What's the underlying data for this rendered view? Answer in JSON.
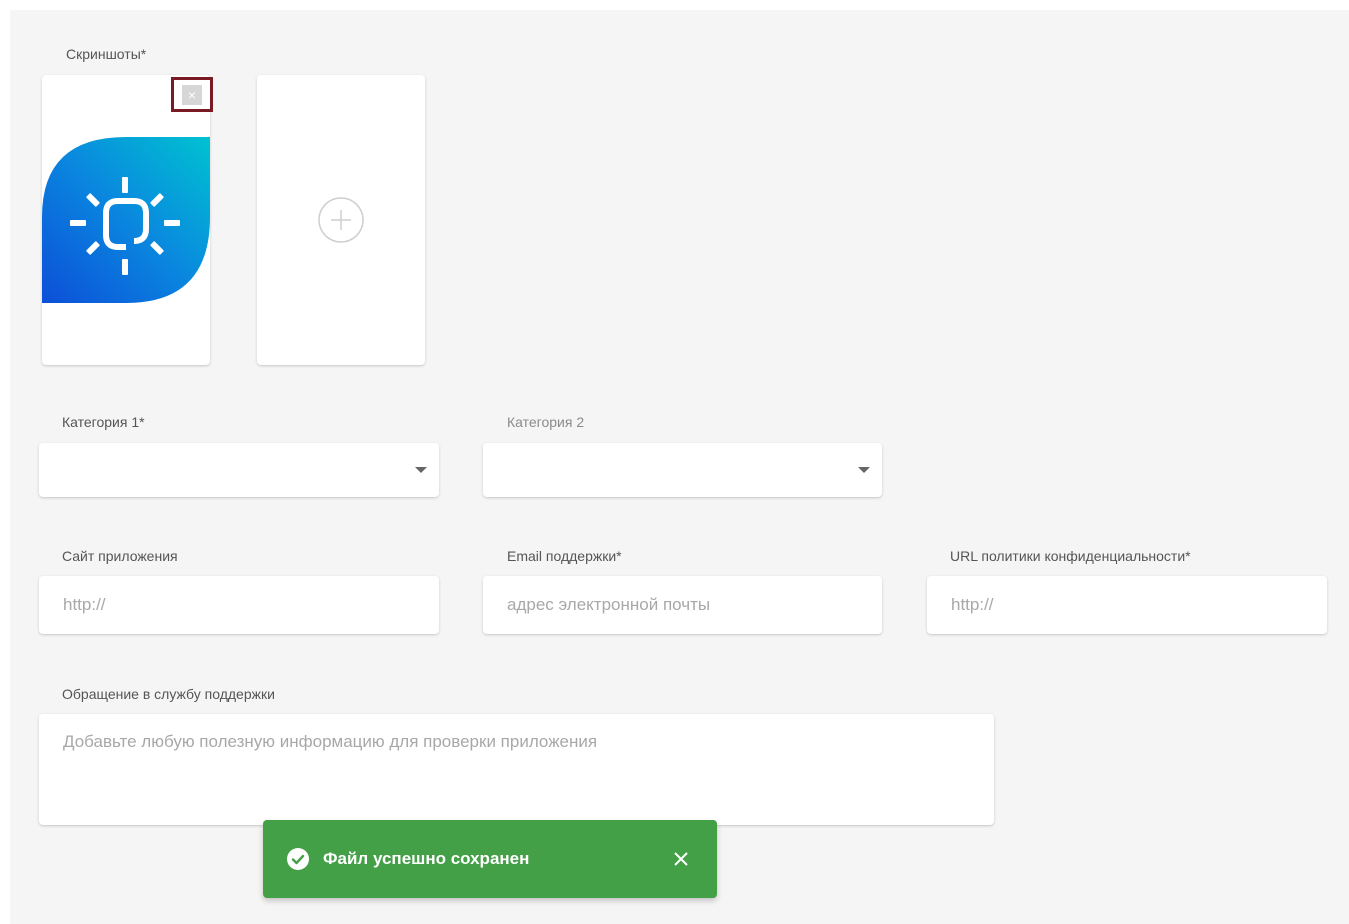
{
  "screenshots": {
    "label": "Скриншоты*",
    "remove_symbol": "×",
    "add_icon": "plus-circle-icon"
  },
  "category1": {
    "label": "Категория 1*",
    "value": ""
  },
  "category2": {
    "label": "Категория 2",
    "value": ""
  },
  "site": {
    "label": "Сайт приложения",
    "placeholder": "http://",
    "value": ""
  },
  "support_email": {
    "label": "Email поддержки*",
    "placeholder": "адрес электронной почты",
    "value": ""
  },
  "privacy_url": {
    "label": "URL политики конфиденциальности*",
    "placeholder": "http://",
    "value": ""
  },
  "support_note": {
    "label": "Обращение в службу поддержки",
    "placeholder": "Добавьте любую полезную информацию для проверки приложения",
    "value": ""
  },
  "toast": {
    "message": "Файл успешно сохранен",
    "icon": "check-circle-icon",
    "color": "#43a047"
  },
  "colors": {
    "highlight_border": "#7a1a24",
    "logo_gradient_start": "#00bcd4",
    "logo_gradient_end": "#0d47d9"
  }
}
